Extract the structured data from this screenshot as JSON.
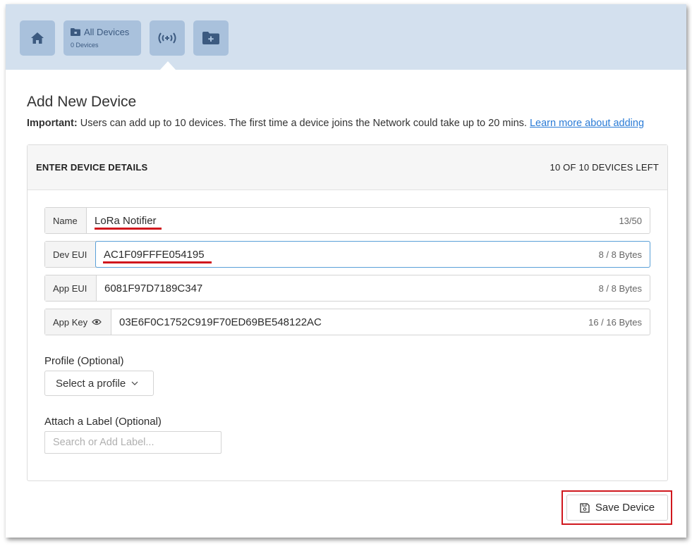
{
  "toolbar": {
    "home_icon": "home-icon",
    "all_devices_label": "All Devices",
    "all_devices_count": "0 Devices",
    "lora_icon": "broadcast-icon",
    "add_folder_icon": "folder-plus-icon",
    "bg_color": "#d3e0ee",
    "button_color": "#a9c1dc",
    "icon_color": "#3c5a80"
  },
  "page": {
    "title": "Add New Device",
    "notice_bold": "Important:",
    "notice_text": " Users can add up to 10 devices. The first time a device joins the Network could take up to 20 mins. ",
    "notice_link": "Learn more about adding"
  },
  "card": {
    "title": "ENTER DEVICE DETAILS",
    "devices_left": "10 OF 10 DEVICES LEFT"
  },
  "fields": {
    "name": {
      "label": "Name",
      "value": "LoRa Notifier",
      "count": "13/50"
    },
    "dev_eui": {
      "label": "Dev EUI",
      "value": "AC1F09FFFE054195",
      "count": "8 / 8 Bytes"
    },
    "app_eui": {
      "label": "App EUI",
      "value": "6081F97D7189C347",
      "count": "8 / 8 Bytes"
    },
    "app_key": {
      "label": "App Key",
      "value": "03E6F0C1752C919F70ED69BE548122AC",
      "count": "16 / 16 Bytes"
    }
  },
  "profile": {
    "label": "Profile (Optional)",
    "select_value": "Select a profile"
  },
  "label_section": {
    "label": "Attach a Label (Optional)",
    "placeholder": "Search or Add Label..."
  },
  "save_button": {
    "label": "Save Device"
  },
  "annotation_color": "#d0181e",
  "link_color": "#2a7bd6"
}
